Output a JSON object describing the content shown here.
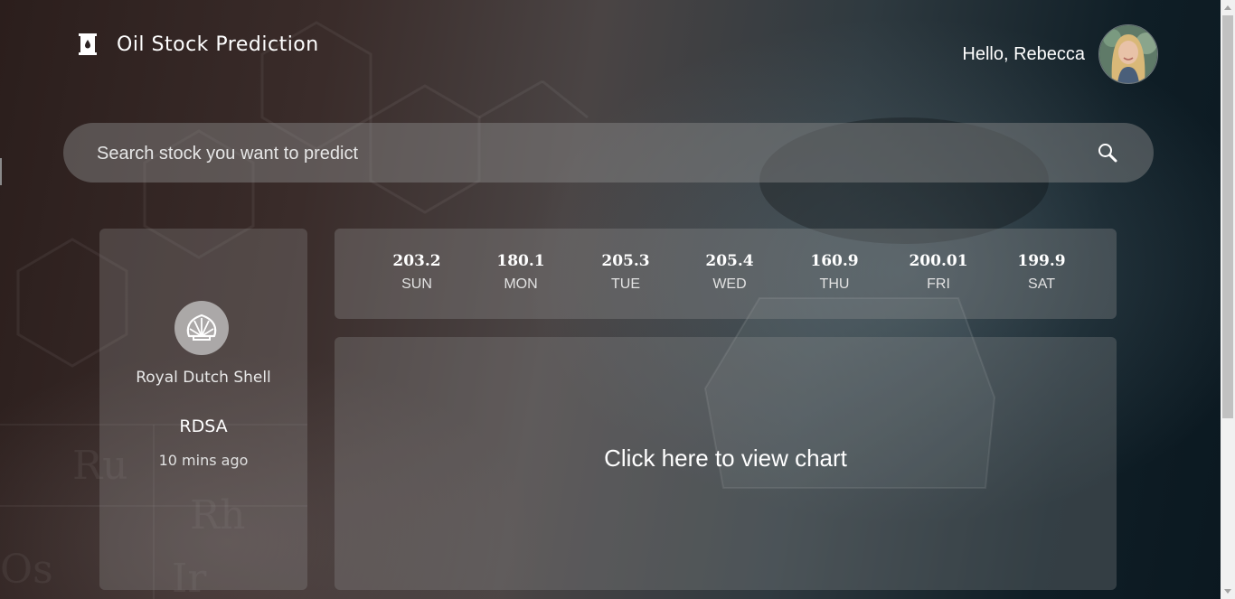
{
  "header": {
    "app_title": "Oil Stock Prediction",
    "greeting": "Hello, Rebecca"
  },
  "search": {
    "placeholder": "Search stock you want to predict"
  },
  "stock": {
    "company_name": "Royal Dutch Shell",
    "ticker": "RDSA",
    "updated": "10 mins ago"
  },
  "forecast": [
    {
      "value": "203.2",
      "day": "SUN"
    },
    {
      "value": "180.1",
      "day": "MON"
    },
    {
      "value": "205.3",
      "day": "TUE"
    },
    {
      "value": "205.4",
      "day": "WED"
    },
    {
      "value": "160.9",
      "day": "THU"
    },
    {
      "value": "200.01",
      "day": "FRI"
    },
    {
      "value": "199.9",
      "day": "SAT"
    }
  ],
  "chart_panel": {
    "link_label": "Click here to view chart"
  },
  "icons": {
    "logo": "oil-barrel-icon",
    "search": "search-icon",
    "company": "shell-logo-icon"
  },
  "colors": {
    "panel_bg": "#969696",
    "text": "#ffffff"
  }
}
